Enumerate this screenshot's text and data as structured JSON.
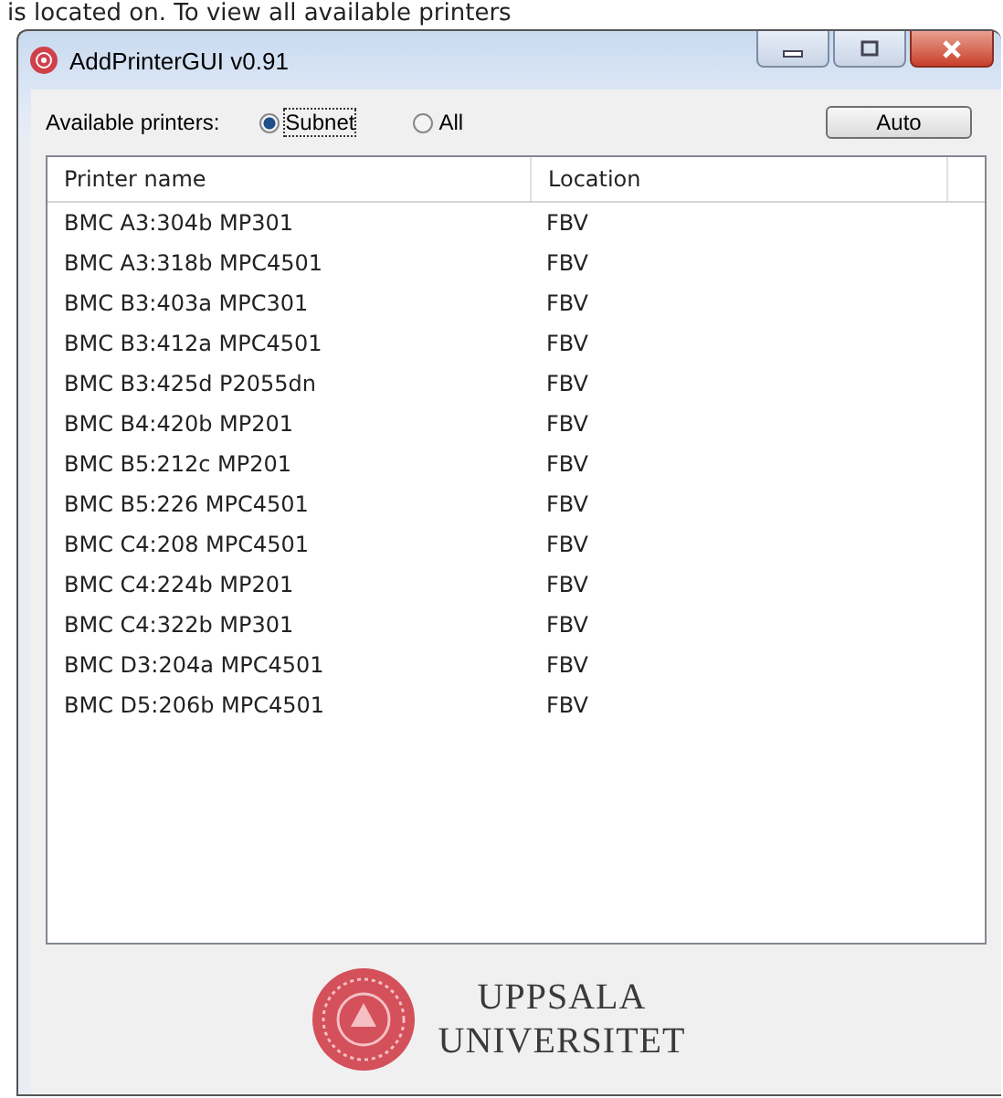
{
  "background_text": "is located on. To view all available printers",
  "window": {
    "title": "AddPrinterGUI v0.91"
  },
  "filter": {
    "label": "Available printers:",
    "options": [
      {
        "label": "Subnet",
        "selected": true
      },
      {
        "label": "All",
        "selected": false
      }
    ],
    "button": "Auto"
  },
  "table": {
    "columns": [
      "Printer name",
      "Location"
    ],
    "rows": [
      [
        "BMC A3:304b MP301",
        "FBV"
      ],
      [
        "BMC A3:318b MPC4501",
        "FBV"
      ],
      [
        "BMC B3:403a MPC301",
        "FBV"
      ],
      [
        "BMC B3:412a MPC4501",
        "FBV"
      ],
      [
        "BMC B3:425d P2055dn",
        "FBV"
      ],
      [
        "BMC B4:420b MP201",
        "FBV"
      ],
      [
        "BMC B5:212c MP201",
        "FBV"
      ],
      [
        "BMC B5:226 MPC4501",
        "FBV"
      ],
      [
        "BMC C4:208 MPC4501",
        "FBV"
      ],
      [
        "BMC C4:224b MP201",
        "FBV"
      ],
      [
        "BMC C4:322b MP301",
        "FBV"
      ],
      [
        "BMC D3:204a MPC4501",
        "FBV"
      ],
      [
        "BMC D5:206b MPC4501",
        "FBV"
      ]
    ]
  },
  "logo": {
    "lines": [
      "UPPSALA",
      "UNIVERSITET"
    ]
  }
}
